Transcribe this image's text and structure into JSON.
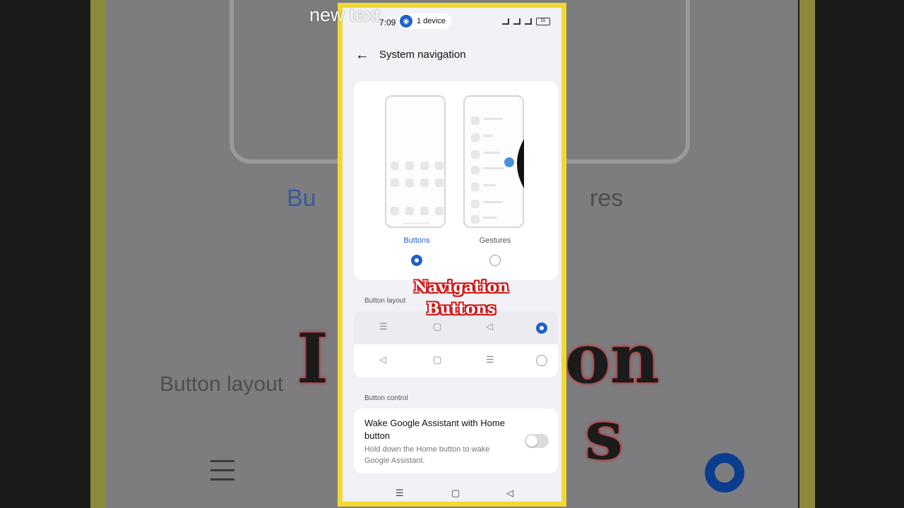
{
  "overlay": {
    "watermark_text": "new text"
  },
  "status_bar": {
    "time": "7:09",
    "hotspot_chip": "1 device",
    "battery": "55"
  },
  "header": {
    "title": "System navigation"
  },
  "navigation_options": [
    {
      "label": "Buttons",
      "selected": true
    },
    {
      "label": "Gestures",
      "selected": false
    }
  ],
  "button_layout": {
    "section_label": "Button layout",
    "rows": [
      {
        "buttons": [
          "menu",
          "home",
          "back"
        ],
        "selected": true
      },
      {
        "buttons": [
          "back",
          "home",
          "menu"
        ],
        "selected": false
      }
    ]
  },
  "button_control": {
    "section_label": "Button control",
    "setting_title": "Wake Google Assistant with Home button",
    "setting_description": "Hold down the Home button to wake Google Assistant.",
    "toggle_on": false
  },
  "caption": {
    "line1": "Navigation",
    "line2": "Buttons"
  },
  "background_echo": {
    "left_label": "Bu",
    "right_label": "res",
    "bottom_label": "Button layout"
  },
  "colors": {
    "accent": "#1f62c8",
    "frame": "#f2d932",
    "caption_outline": "#d01818"
  }
}
